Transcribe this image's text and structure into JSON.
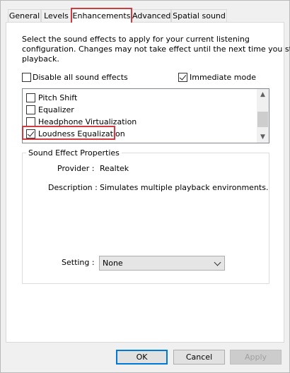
{
  "tabs": [
    "General",
    "Levels",
    "Enhancements",
    "Advanced",
    "Spatial sound"
  ],
  "description": [
    "Select the sound effects to apply for your current listening",
    "configuration. Changes may not take effect until the next time you start",
    "playback."
  ],
  "options": {
    "disable_all": {
      "label": "Disable all sound effects",
      "checked": false
    },
    "immediate_mode": {
      "label": "Immediate mode",
      "checked": true
    }
  },
  "effects": [
    {
      "label": "Pitch Shift",
      "checked": false
    },
    {
      "label": "Equalizer",
      "checked": false
    },
    {
      "label": "Headphone Virtualization",
      "checked": false
    },
    {
      "label": "Loudness Equalization",
      "checked": true
    }
  ],
  "properties": {
    "title": "Sound Effect Properties",
    "provider_label": "Provider :",
    "provider_value": "Realtek",
    "description_label": "Description :",
    "description_value": "Simulates multiple playback environments.",
    "setting_label": "Setting :",
    "setting_value": "None"
  },
  "buttons": {
    "ok": "OK",
    "cancel": "Cancel",
    "apply": "Apply"
  },
  "colors": {
    "highlight": "#d23a3f",
    "focus": "#0078d7"
  }
}
